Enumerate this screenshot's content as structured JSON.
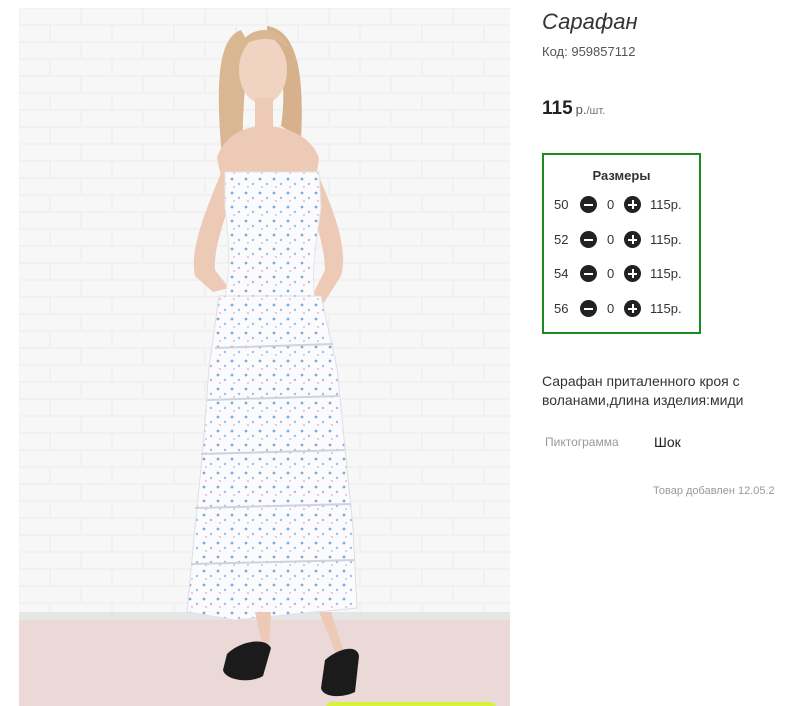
{
  "product": {
    "title": "Сарафан",
    "code_label": "Код:",
    "code": "959857112",
    "price": "115",
    "currency": "р.",
    "unit": "/шт.",
    "description": "Сарафан приталенного кроя с воланами,длина изделия:миди",
    "pictogram_label": "Пиктограмма",
    "pictogram_value": "Шок",
    "added_text": "Товар добавлен 12.05.2"
  },
  "sizes": {
    "title": "Размеры",
    "rows": [
      {
        "size": "50",
        "qty": "0",
        "price": "115р."
      },
      {
        "size": "52",
        "qty": "0",
        "price": "115р."
      },
      {
        "size": "54",
        "qty": "0",
        "price": "115р."
      },
      {
        "size": "56",
        "qty": "0",
        "price": "115р."
      }
    ]
  },
  "colors": {
    "sizes_border": "#1d8a1d",
    "photo_action": "#d6f23a"
  }
}
